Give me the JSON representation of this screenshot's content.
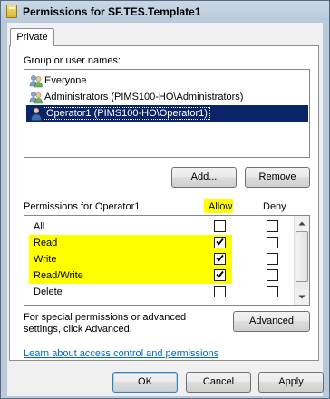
{
  "window": {
    "title": "Permissions for SF.TES.Template1",
    "icon": "folder-icon"
  },
  "tabs": [
    {
      "label": "Private"
    }
  ],
  "users": {
    "label": "Group or user names:",
    "items": [
      {
        "label": "Everyone",
        "icon": "group-icon",
        "selected": false
      },
      {
        "label": "Administrators (PIMS100-HO\\Administrators)",
        "icon": "group-icon",
        "selected": false
      },
      {
        "label": "Operator1 (PIMS100-HO\\Operator1)",
        "icon": "user-icon",
        "selected": true
      }
    ],
    "add_label": "Add...",
    "remove_label": "Remove"
  },
  "permissions": {
    "label": "Permissions for Operator1",
    "allow_label": "Allow",
    "deny_label": "Deny",
    "highlight_color": "#ffff00",
    "rows": [
      {
        "name": "All",
        "allow": false,
        "deny": false,
        "highlighted": false
      },
      {
        "name": "Read",
        "allow": true,
        "deny": false,
        "highlighted": true
      },
      {
        "name": "Write",
        "allow": true,
        "deny": false,
        "highlighted": true
      },
      {
        "name": "Read/Write",
        "allow": true,
        "deny": false,
        "highlighted": true
      },
      {
        "name": "Delete",
        "allow": false,
        "deny": false,
        "highlighted": false
      }
    ]
  },
  "special": {
    "text": "For special permissions or advanced settings, click Advanced.",
    "advanced_label": "Advanced"
  },
  "link_text": "Learn about access control and permissions",
  "footer": {
    "ok_label": "OK",
    "cancel_label": "Cancel",
    "apply_label": "Apply"
  }
}
